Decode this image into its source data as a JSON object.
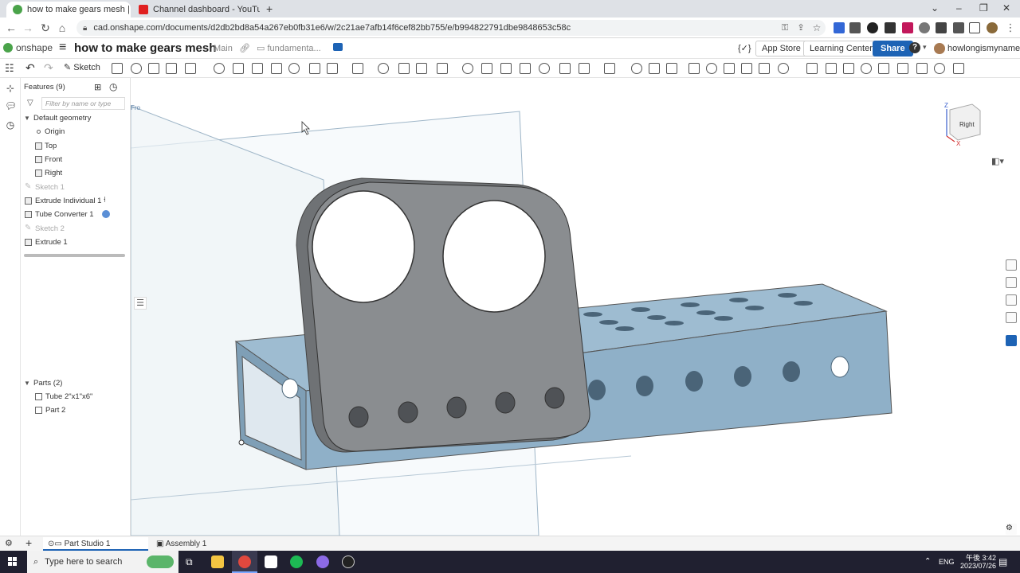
{
  "browser": {
    "tabs": [
      {
        "title": "how to make gears mesh | Part S",
        "active": true,
        "favicon_color": "#4aa34a"
      },
      {
        "title": "Channel dashboard - YouTube St",
        "active": false,
        "favicon_color": "#e02020"
      }
    ],
    "new_tab_label": "+",
    "url": "cad.onshape.com/documents/d2db2bd8a54a267eb0fb31e6/w/2c21ae7afb14f6cef82bb755/e/b994822791dbe9848653c58c"
  },
  "header": {
    "logo_text": "onshape",
    "document_title": "how to make gears mesh",
    "branch": "Main",
    "folder": "fundamenta...",
    "app_store_label": "App Store",
    "learning_center_label": "Learning Center",
    "share_label": "Share",
    "help_label": "?",
    "username": "howlongismyname"
  },
  "toolbar": {
    "sketch_label": "Sketch"
  },
  "feature_panel": {
    "features_header": "Features (9)",
    "filter_placeholder": "Filter by name or type",
    "default_geometry_label": "Default geometry",
    "geometry_items": [
      "Origin",
      "Top",
      "Front",
      "Right"
    ],
    "features": [
      {
        "name": "Sketch 1",
        "suppressed": true
      },
      {
        "name": "Extrude Individual 1",
        "suppressed": false
      },
      {
        "name": "Tube Converter 1",
        "suppressed": false
      },
      {
        "name": "Sketch 2",
        "suppressed": true
      },
      {
        "name": "Extrude 1",
        "suppressed": false
      }
    ],
    "parts_header": "Parts (2)",
    "parts": [
      "Tube 2\"x1\"x6\"",
      "Part 2"
    ]
  },
  "viewport": {
    "viewcube_face": "Right",
    "axis_z": "Z",
    "axis_x": "X",
    "plane_label": "Fro",
    "tube_color": "#8fb0c8",
    "part_color": "#8a8d90"
  },
  "bottom_tabs": {
    "tabs": [
      "Part Studio 1",
      "Assembly 1"
    ],
    "active_index": 0
  },
  "taskbar": {
    "search_placeholder": "Type here to search",
    "language": "ENG",
    "time": "午後 3:42",
    "date": "2023/07/26"
  }
}
